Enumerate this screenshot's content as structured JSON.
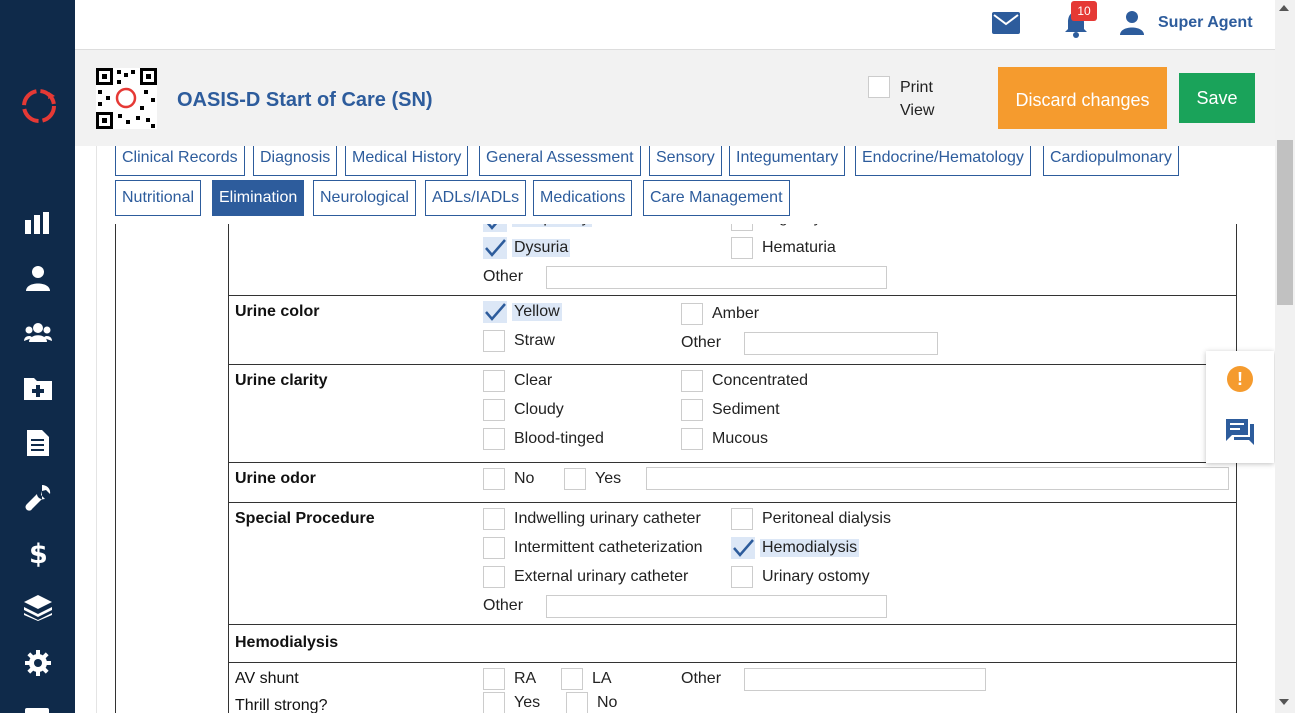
{
  "header": {
    "user_name": "Super Agent",
    "notification_count": "10"
  },
  "form": {
    "title": "OASIS-D Start of Care (SN)",
    "print_view_label": "Print View",
    "discard_label": "Discard changes",
    "save_label": "Save"
  },
  "tabs": [
    {
      "label": "Clinical Records"
    },
    {
      "label": "Diagnosis"
    },
    {
      "label": "Medical History"
    },
    {
      "label": "General Assessment"
    },
    {
      "label": "Sensory"
    },
    {
      "label": "Integumentary"
    },
    {
      "label": "Endocrine/Hematology"
    },
    {
      "label": "Cardiopulmonary"
    },
    {
      "label": "Nutritional"
    },
    {
      "label": "Elimination",
      "active": true
    },
    {
      "label": "Neurological"
    },
    {
      "label": "ADLs/IADLs"
    },
    {
      "label": "Medications"
    },
    {
      "label": "Care Management"
    }
  ],
  "symptoms": {
    "partial_left": "Frequency",
    "partial_right": "Urgency/Anuria",
    "dysuria": "Dysuria",
    "dysuria_checked": true,
    "hematuria": "Hematuria",
    "other": "Other"
  },
  "urine_color": {
    "label": "Urine color",
    "yellow": "Yellow",
    "yellow_checked": true,
    "amber": "Amber",
    "straw": "Straw",
    "other": "Other"
  },
  "urine_clarity": {
    "label": "Urine clarity",
    "clear": "Clear",
    "concentrated": "Concentrated",
    "cloudy": "Cloudy",
    "sediment": "Sediment",
    "blood_tinged": "Blood-tinged",
    "mucous": "Mucous"
  },
  "urine_odor": {
    "label": "Urine odor",
    "no": "No",
    "yes": "Yes"
  },
  "special_procedure": {
    "label": "Special Procedure",
    "indwelling": "Indwelling urinary catheter",
    "peritoneal": "Peritoneal dialysis",
    "intermittent": "Intermittent catheterization",
    "hemodialysis": "Hemodialysis",
    "hemodialysis_checked": true,
    "external": "External urinary catheter",
    "ostomy": "Urinary ostomy",
    "other": "Other"
  },
  "hemodialysis": {
    "label": "Hemodialysis",
    "av_shunt": "AV shunt",
    "ra": "RA",
    "la": "LA",
    "other": "Other",
    "thrill": "Thrill strong?",
    "yes": "Yes",
    "no": "No"
  },
  "colors": {
    "sidebar": "#0f2a4a",
    "primary": "#2d5c9c",
    "discard": "#f59b2e",
    "save": "#1aa35a",
    "badge": "#e53935"
  }
}
